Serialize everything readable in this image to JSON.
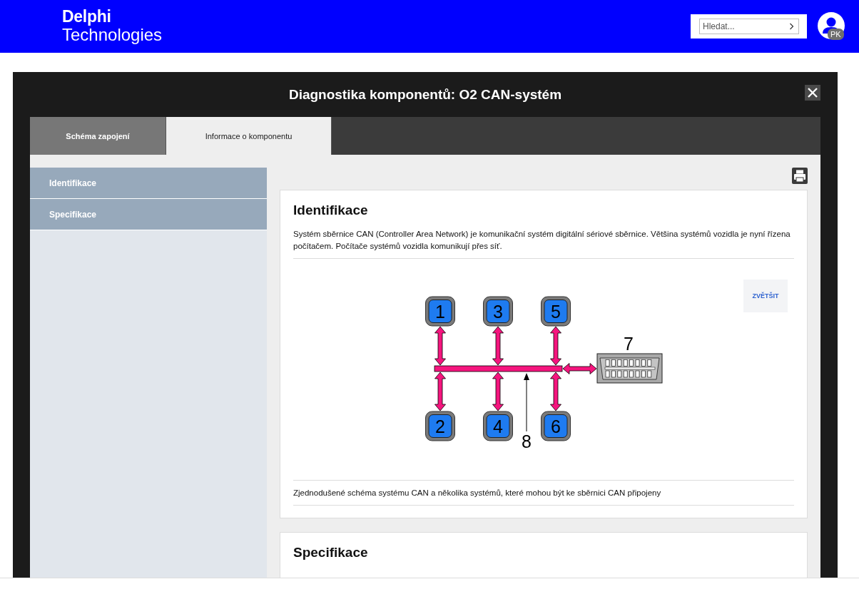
{
  "header": {
    "logo": {
      "line_1": "Delphi",
      "line_2": "Technologies"
    },
    "search": {
      "placeholder": "Hledat..."
    },
    "user": {
      "initials": "PK"
    }
  },
  "dialog": {
    "title": "Diagnostika komponentů: O2 CAN-systém",
    "tabs": [
      {
        "label": "Schéma zapojení",
        "selected": false
      },
      {
        "label": "Informace o komponentu",
        "selected": true
      }
    ]
  },
  "sidebar": {
    "items": [
      {
        "label": "Identifikace"
      },
      {
        "label": "Specifikace"
      }
    ]
  },
  "sections": [
    {
      "title": "Identifikace",
      "text": "Systém sběrnice CAN (Controller Area Network) je komunikační systém digitální sériové sběrnice. Většina systémů vozidla je nyní řízena počítačem. Počítače systémů vozidla komunikují přes síť.",
      "figure": {
        "zoom_button": "ZVĚTŠIT",
        "module_columns": [
          [
            "1",
            "2"
          ],
          [
            "3",
            "4"
          ],
          [
            "5",
            "6"
          ]
        ],
        "connector_label": "7",
        "bus_label": "8"
      },
      "caption": "Zjednodušené schéma systému CAN a několika systémů, které mohou být ke sběrnici CAN připojeny"
    },
    {
      "title": "Specifikace"
    }
  ]
}
